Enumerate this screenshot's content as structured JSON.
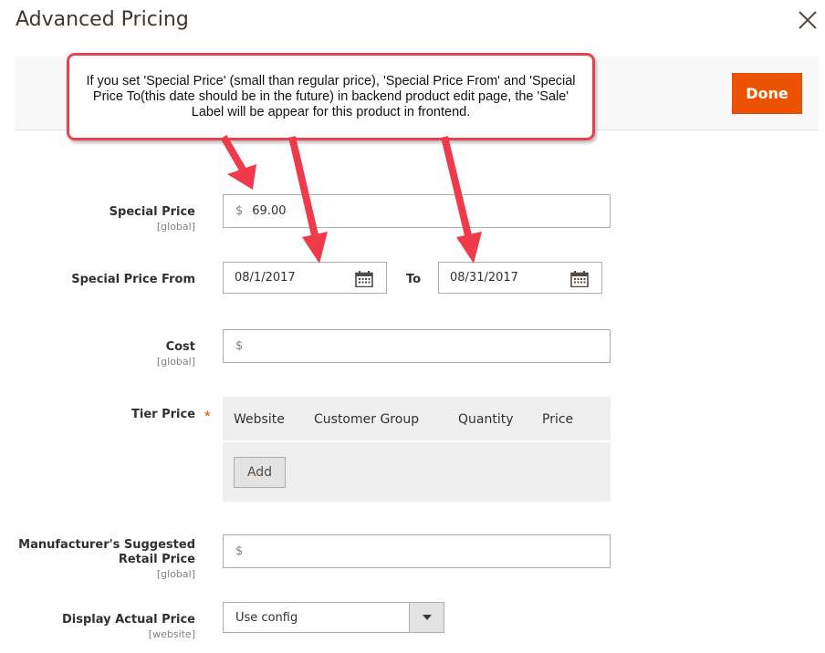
{
  "header": {
    "title": "Advanced Pricing"
  },
  "toolbar": {
    "done_label": "Done"
  },
  "callout": {
    "text": "If you set 'Special Price' (small than regular price), 'Special Price From' and 'Special Price To(this date should be in the future) in backend product edit page, the 'Sale' Label will be appear for this product in frontend."
  },
  "fields": {
    "special_price": {
      "label": "Special Price",
      "scope": "[global]",
      "currency": "$",
      "value": "69.00"
    },
    "special_from": {
      "label": "Special Price From",
      "value": "08/1/2017",
      "to_label": "To",
      "to_value": "08/31/2017"
    },
    "cost": {
      "label": "Cost",
      "scope": "[global]",
      "currency": "$",
      "value": ""
    },
    "tier_price": {
      "label": "Tier Price",
      "required_mark": "*",
      "columns": [
        "Website",
        "Customer Group",
        "Quantity",
        "Price"
      ],
      "add_label": "Add"
    },
    "msrp": {
      "label_line1": "Manufacturer's Suggested",
      "label_line2": "Retail Price",
      "scope": "[global]",
      "currency": "$",
      "value": ""
    },
    "display_actual": {
      "label": "Display Actual Price",
      "scope": "[website]",
      "selected": "Use config"
    }
  },
  "icons": {
    "close": "close-icon",
    "calendar": "calendar-icon",
    "dropdown": "caret-down-icon"
  },
  "colors": {
    "accent": "#eb5202",
    "callout_border": "#e8424f",
    "arrow": "#ee3a4a"
  }
}
